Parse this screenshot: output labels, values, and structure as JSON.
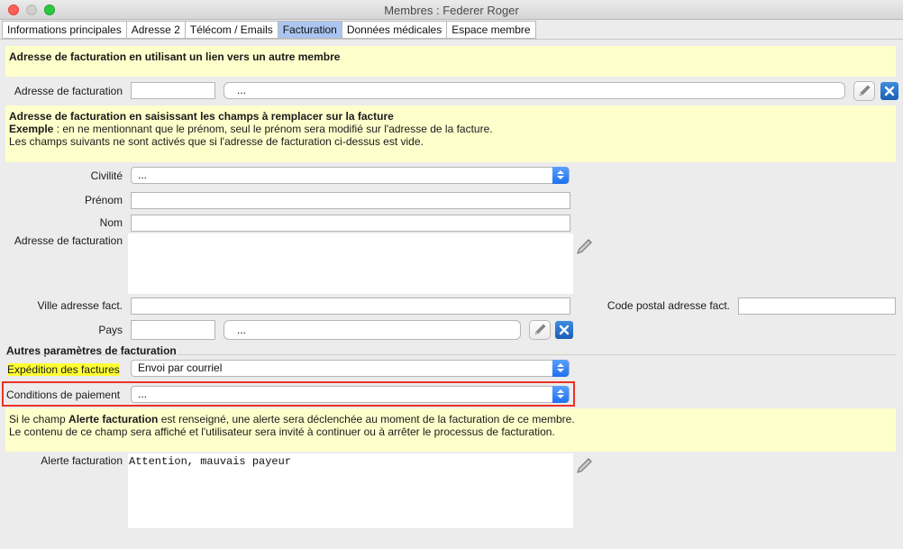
{
  "window": {
    "title": "Membres : Federer Roger"
  },
  "tabs": [
    {
      "label": "Informations principales"
    },
    {
      "label": "Adresse 2"
    },
    {
      "label": "Télécom / Emails"
    },
    {
      "label": "Facturation"
    },
    {
      "label": "Données médicales"
    },
    {
      "label": "Espace membre"
    }
  ],
  "active_tab": "Facturation",
  "info1": {
    "title": "Adresse de facturation en utilisant un lien vers un autre membre"
  },
  "billing_link": {
    "label": "Adresse de facturation",
    "code_value": "",
    "name_value": "..."
  },
  "info2": {
    "title": "Adresse de facturation en saisissant les champs à remplacer sur la facture",
    "example_label": "Exemple",
    "example_text": " : en ne mentionnant que le prénom, seul le prénom sera modifié sur l'adresse de la facture.",
    "line3": "Les champs suivants ne sont activés que si l'adresse de facturation ci-dessus est vide."
  },
  "fields": {
    "civilite": {
      "label": "Civilité",
      "value": "..."
    },
    "prenom": {
      "label": "Prénom",
      "value": ""
    },
    "nom": {
      "label": "Nom",
      "value": ""
    },
    "adresse": {
      "label": "Adresse de facturation",
      "value": ""
    },
    "ville": {
      "label": "Ville adresse fact.",
      "value": ""
    },
    "code_postal": {
      "label": "Code postal adresse fact.",
      "value": ""
    },
    "pays": {
      "label": "Pays",
      "code_value": "",
      "name_value": "..."
    }
  },
  "other_params": {
    "title": "Autres paramètres de facturation",
    "expedition": {
      "label": "Expédition des factures",
      "value": "Envoi par courriel"
    },
    "conditions": {
      "label": "Conditions de paiement",
      "value": "..."
    }
  },
  "info3": {
    "pre": "Si le champ ",
    "bold": "Alerte facturation",
    "post": " est renseigné, une alerte sera déclenchée au moment de la facturation de ce membre.",
    "line2": "Le contenu de ce champ sera affiché et l'utilisateur sera invité à continuer ou à arrêter le processus de facturation."
  },
  "alerte": {
    "label": "Alerte facturation",
    "value": "Attention, mauvais payeur"
  },
  "colors": {
    "info_bg": "#ffffcc",
    "active_tab": "#aac5f0",
    "highlight": "#ffff33",
    "red_box": "#ea3323",
    "select_arrow": "#1f6ff0"
  }
}
